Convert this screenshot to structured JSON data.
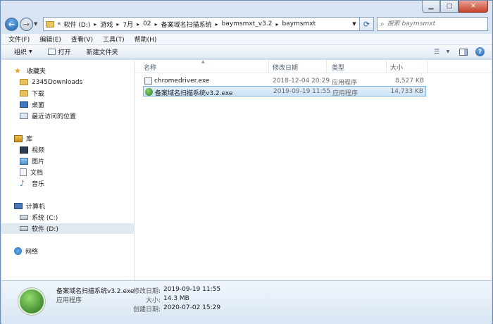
{
  "window": {
    "caption": {
      "minimize": "▁",
      "maximize": "□",
      "close": "✕"
    }
  },
  "address": {
    "prefix": "«",
    "crumbs": [
      "软件 (D:)",
      "游戏",
      "7月",
      "02",
      "备案域名扫描系统",
      "baymsmxt_v3.2",
      "baymsmxt"
    ]
  },
  "search": {
    "placeholder": "搜索 baymsmxt"
  },
  "menu": [
    "文件(F)",
    "编辑(E)",
    "查看(V)",
    "工具(T)",
    "帮助(H)"
  ],
  "toolbar": {
    "organize": "组织",
    "open": "打开",
    "new_folder": "新建文件夹"
  },
  "nav": {
    "favorites": "收藏夹",
    "fav_items": [
      "2345Downloads",
      "下载",
      "桌面",
      "最近访问的位置"
    ],
    "libraries": "库",
    "lib_items": [
      "视频",
      "图片",
      "文档",
      "音乐"
    ],
    "computer": "计算机",
    "drives": [
      "系统 (C:)",
      "软件 (D:)"
    ],
    "network": "网络"
  },
  "columns": {
    "name": "名称",
    "modified": "修改日期",
    "type": "类型",
    "size": "大小"
  },
  "files": [
    {
      "name": "chromedriver.exe",
      "modified": "2018-12-04 20:29",
      "type": "应用程序",
      "size": "8,527 KB"
    },
    {
      "name": "备案域名扫描系统v3.2.exe",
      "modified": "2019-09-19 11:55",
      "type": "应用程序",
      "size": "14,733 KB"
    }
  ],
  "details": {
    "name": "备案域名扫描系统v3.2.exe",
    "kind": "应用程序",
    "modified_label": "修改日期:",
    "modified": "2019-09-19 11:55",
    "size_label": "大小:",
    "size": "14.3 MB",
    "created_label": "创建日期:",
    "created": "2020-07-02 15:29"
  }
}
